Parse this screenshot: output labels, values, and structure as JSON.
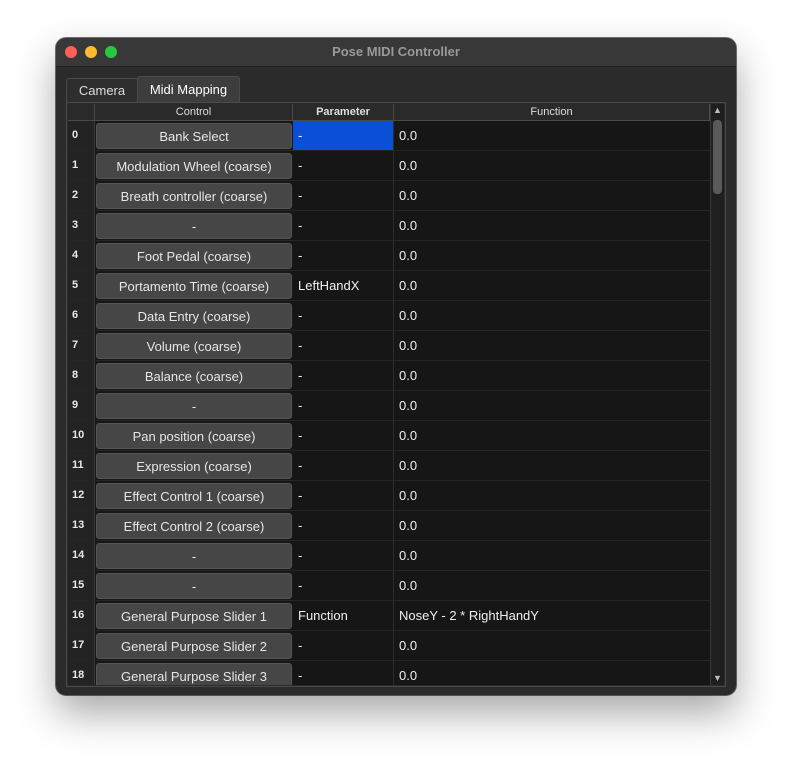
{
  "window": {
    "title": "Pose MIDI Controller"
  },
  "tabs": [
    {
      "label": "Camera",
      "active": false
    },
    {
      "label": "Midi Mapping",
      "active": true
    }
  ],
  "table": {
    "headers": {
      "control": "Control",
      "parameter": "Parameter",
      "function": "Function"
    },
    "selected_color": "#0a4fd8",
    "rows": [
      {
        "num": "0",
        "control": "Bank Select",
        "parameter": "-",
        "function": "0.0"
      },
      {
        "num": "1",
        "control": "Modulation Wheel (coarse)",
        "parameter": "-",
        "function": "0.0"
      },
      {
        "num": "2",
        "control": "Breath controller (coarse)",
        "parameter": "-",
        "function": "0.0"
      },
      {
        "num": "3",
        "control": "-",
        "parameter": "-",
        "function": "0.0"
      },
      {
        "num": "4",
        "control": "Foot Pedal (coarse)",
        "parameter": "-",
        "function": "0.0"
      },
      {
        "num": "5",
        "control": "Portamento Time (coarse)",
        "parameter": "LeftHandX",
        "function": "0.0"
      },
      {
        "num": "6",
        "control": "Data Entry (coarse)",
        "parameter": "-",
        "function": "0.0"
      },
      {
        "num": "7",
        "control": "Volume (coarse)",
        "parameter": "-",
        "function": "0.0"
      },
      {
        "num": "8",
        "control": "Balance (coarse)",
        "parameter": "-",
        "function": "0.0"
      },
      {
        "num": "9",
        "control": "-",
        "parameter": "-",
        "function": "0.0"
      },
      {
        "num": "10",
        "control": "Pan position (coarse)",
        "parameter": "-",
        "function": "0.0"
      },
      {
        "num": "11",
        "control": "Expression (coarse)",
        "parameter": "-",
        "function": "0.0"
      },
      {
        "num": "12",
        "control": "Effect Control 1 (coarse)",
        "parameter": "-",
        "function": "0.0"
      },
      {
        "num": "13",
        "control": "Effect Control 2 (coarse)",
        "parameter": "-",
        "function": "0.0"
      },
      {
        "num": "14",
        "control": "-",
        "parameter": "-",
        "function": "0.0"
      },
      {
        "num": "15",
        "control": "-",
        "parameter": "-",
        "function": "0.0"
      },
      {
        "num": "16",
        "control": "General Purpose Slider 1",
        "parameter": "Function",
        "function": "NoseY - 2 * RightHandY"
      },
      {
        "num": "17",
        "control": "General Purpose Slider 2",
        "parameter": "-",
        "function": "0.0"
      },
      {
        "num": "18",
        "control": "General Purpose Slider 3",
        "parameter": "-",
        "function": "0.0"
      }
    ]
  },
  "icons": {
    "scroll_up": "scroll-up-arrow-icon",
    "scroll_down": "scroll-down-arrow-icon"
  }
}
